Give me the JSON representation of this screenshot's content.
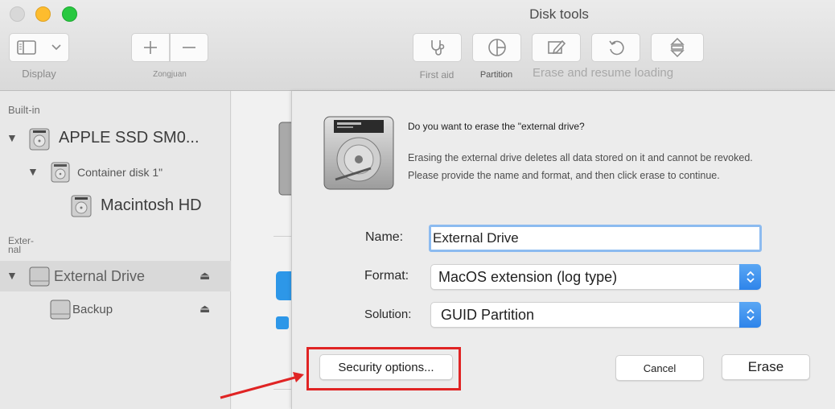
{
  "window": {
    "title": "Disk tools",
    "traffic_lights": {
      "close": "#d8d8d8",
      "minimize": "#fdbc2e",
      "maximize": "#28c840"
    }
  },
  "toolbar": {
    "display_label": "Display",
    "zongjuan_label": "Zongjuan",
    "first_aid_label": "First aid",
    "partition_label": "Partition",
    "erase_resume_label": "Erase and resume loading"
  },
  "sidebar": {
    "built_in_header": "Built-in",
    "external_header_1": "Exter-",
    "external_header_2": "nal",
    "items": [
      {
        "label": "APPLE SSD SM0...",
        "icon": "internal-disk-icon"
      },
      {
        "label": "Container disk 1\"",
        "icon": "container-disk-icon"
      },
      {
        "label": "Macintosh HD",
        "icon": "volume-icon"
      },
      {
        "label": "External Drive",
        "icon": "external-disk-icon",
        "selected": true
      },
      {
        "label": "Backup",
        "icon": "external-volume-icon"
      }
    ],
    "eject_glyph": "⏏"
  },
  "dialog": {
    "question": "Do you want to erase the \"external drive?",
    "body_line1": "Erasing the external drive deletes all data stored on it and cannot be revoked.",
    "body_line2": "Please provide the name and format, and then click erase to continue.",
    "name_label": "Name:",
    "name_value": "External Drive",
    "format_label": "Format:",
    "format_value": "MacOS extension (log type)",
    "solution_label": "Solution:",
    "solution_value": "GUID Partition",
    "security_button": "Security options...",
    "cancel_button": "Cancel",
    "erase_button": "Erase"
  },
  "colors": {
    "accent": "#2e84ea",
    "highlight": "#e02424",
    "input_focus": "#8cbbf0"
  }
}
